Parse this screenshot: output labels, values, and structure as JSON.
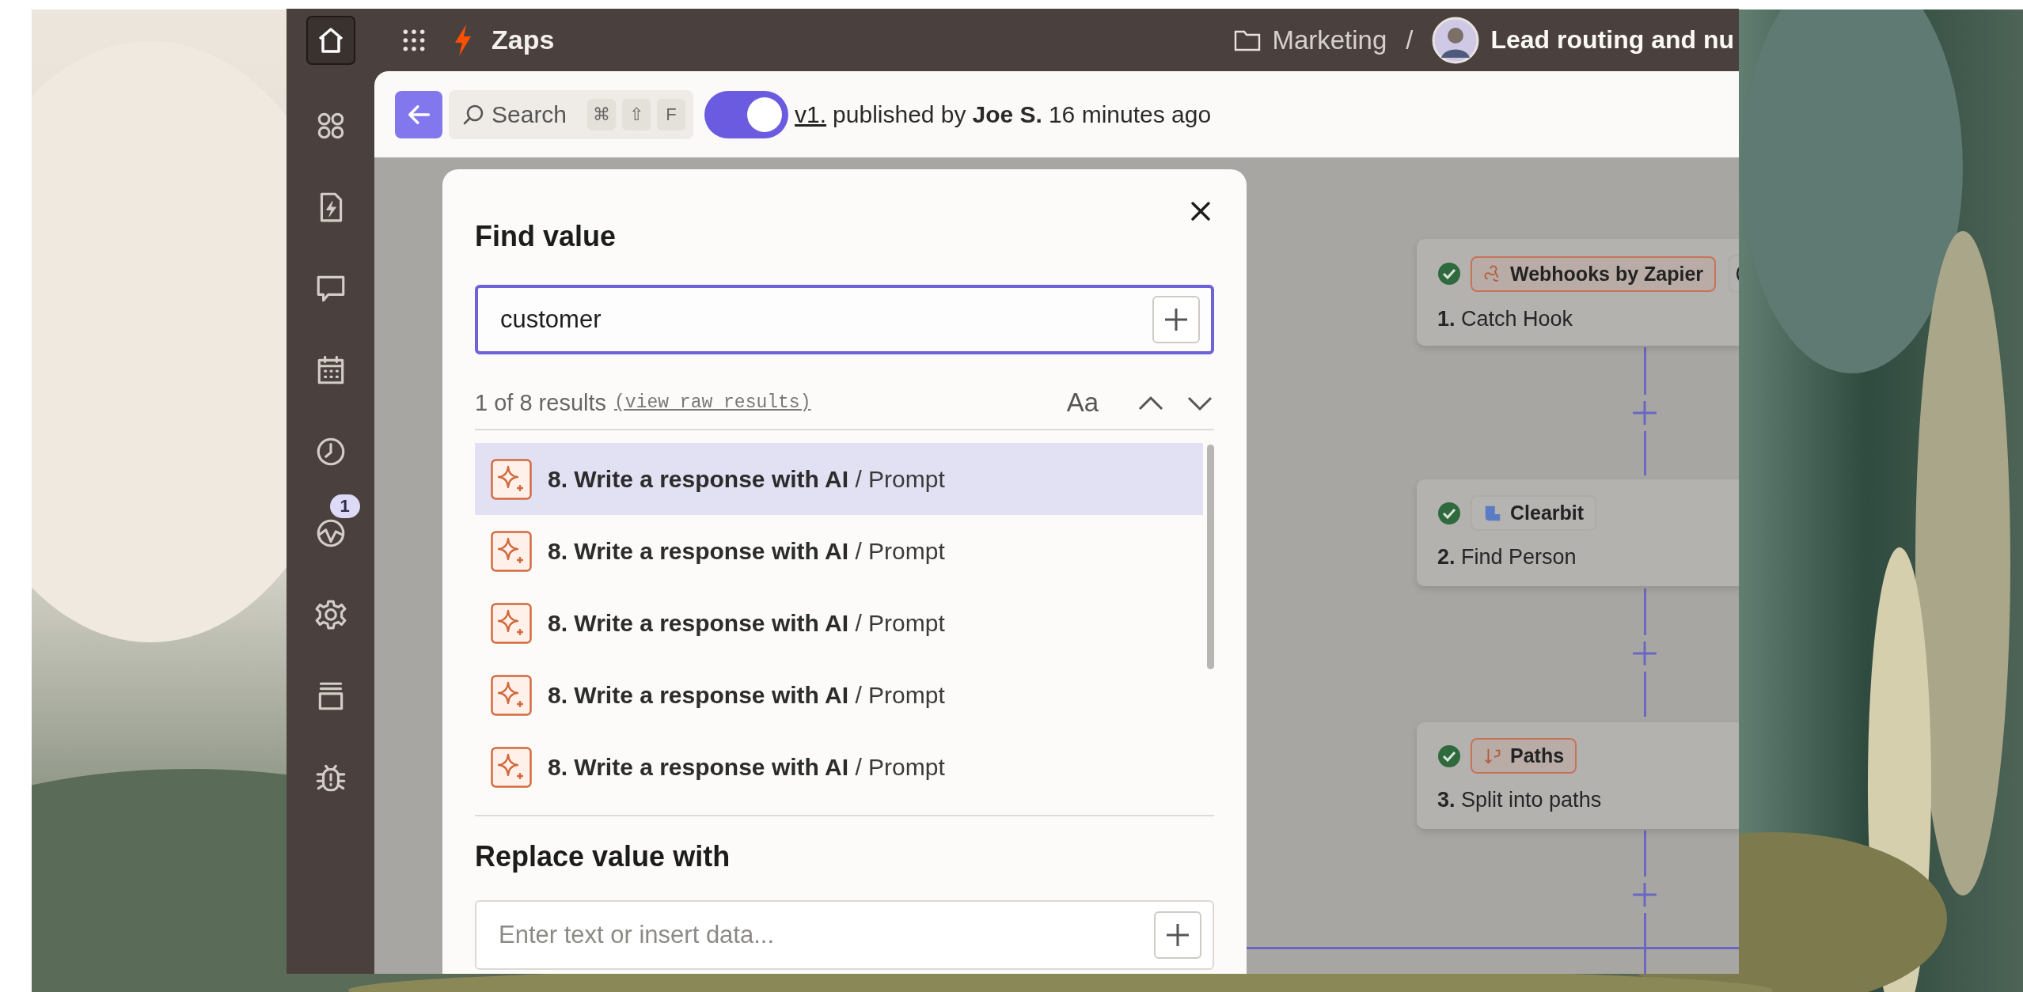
{
  "topbar": {
    "app_title": "Zaps",
    "folder": "Marketing",
    "separator": "/",
    "zap_title": "Lead routing and nu"
  },
  "sidebar": {
    "items": [
      {
        "kind": "apps"
      },
      {
        "kind": "zap-file"
      },
      {
        "kind": "chat"
      },
      {
        "kind": "calendar"
      },
      {
        "kind": "history"
      },
      {
        "kind": "status",
        "badge": "1"
      },
      {
        "kind": "settings"
      },
      {
        "kind": "versions"
      },
      {
        "kind": "debug"
      }
    ]
  },
  "toolbar": {
    "search_label": "Search",
    "shortcut_keys": [
      "⌘",
      "⇧",
      "F"
    ],
    "published": true,
    "version": "v1.",
    "published_text": "published by",
    "author": "Joe S.",
    "time": "16 minutes ago"
  },
  "find_dialog": {
    "title": "Find value",
    "search_value": "customer",
    "results_count": "1 of 8 results",
    "raw_results_link": "(view raw results)",
    "match_case": "Aa",
    "results": [
      {
        "step": "8. Write a response with AI",
        "field": "/ Prompt",
        "selected": true
      },
      {
        "step": "8. Write a response with AI",
        "field": "/ Prompt",
        "selected": false
      },
      {
        "step": "8. Write a response with AI",
        "field": "/ Prompt",
        "selected": false
      },
      {
        "step": "8. Write a response with AI",
        "field": "/ Prompt",
        "selected": false
      },
      {
        "step": "8. Write a response with AI",
        "field": "/ Prompt",
        "selected": false
      }
    ],
    "replace_title": "Replace value with",
    "replace_placeholder": "Enter text or insert data..."
  },
  "canvas": {
    "steps": [
      {
        "kind": "webhooks",
        "app": "Webhooks by Zapier",
        "number": "1.",
        "title": "Catch Hook"
      },
      {
        "kind": "clearbit",
        "app": "Clearbit",
        "number": "2.",
        "title": "Find Person"
      },
      {
        "kind": "paths",
        "app": "Paths",
        "number": "3.",
        "title": "Split into paths"
      }
    ]
  }
}
